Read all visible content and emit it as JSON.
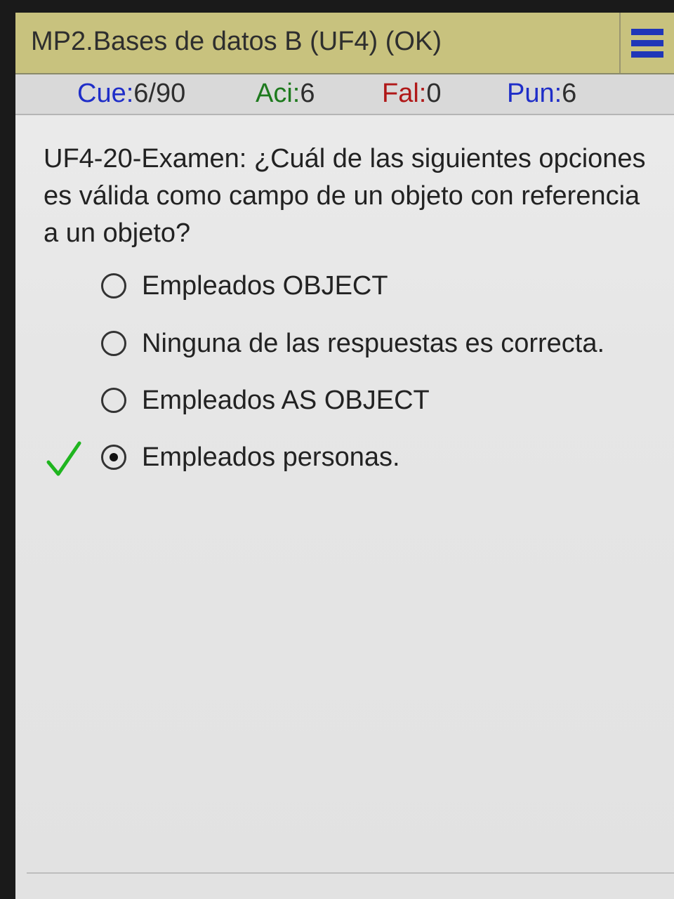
{
  "app_title": "MP2.Bases de datos B (UF4) (OK)",
  "menu_icon": "hamburger-menu-icon",
  "stats": {
    "cue": {
      "label": "Cue:",
      "value": "6/90"
    },
    "aci": {
      "label": "Aci:",
      "value": "6"
    },
    "fal": {
      "label": "Fal:",
      "value": "0"
    },
    "pun": {
      "label": "Pun:",
      "value": "6"
    }
  },
  "question": "UF4-20-Examen: ¿Cuál de las siguientes opciones es válida como campo de un objeto con referencia a un objeto?",
  "options": [
    {
      "label": "Empleados OBJECT",
      "selected": false
    },
    {
      "label": "Ninguna de las respuestas es correcta.",
      "selected": false
    },
    {
      "label": "Empleados AS OBJECT",
      "selected": false
    },
    {
      "label": "Empleados personas.",
      "selected": true,
      "marked_correct": true
    }
  ],
  "colors": {
    "topbar": "#c8c27e",
    "menu_icon": "#1f36b8",
    "cue_label": "#1f2ec8",
    "aci_label": "#1e7a1e",
    "fal_label": "#b01818",
    "pun_label": "#1f2ec8",
    "correct_check": "#1fb51f"
  }
}
